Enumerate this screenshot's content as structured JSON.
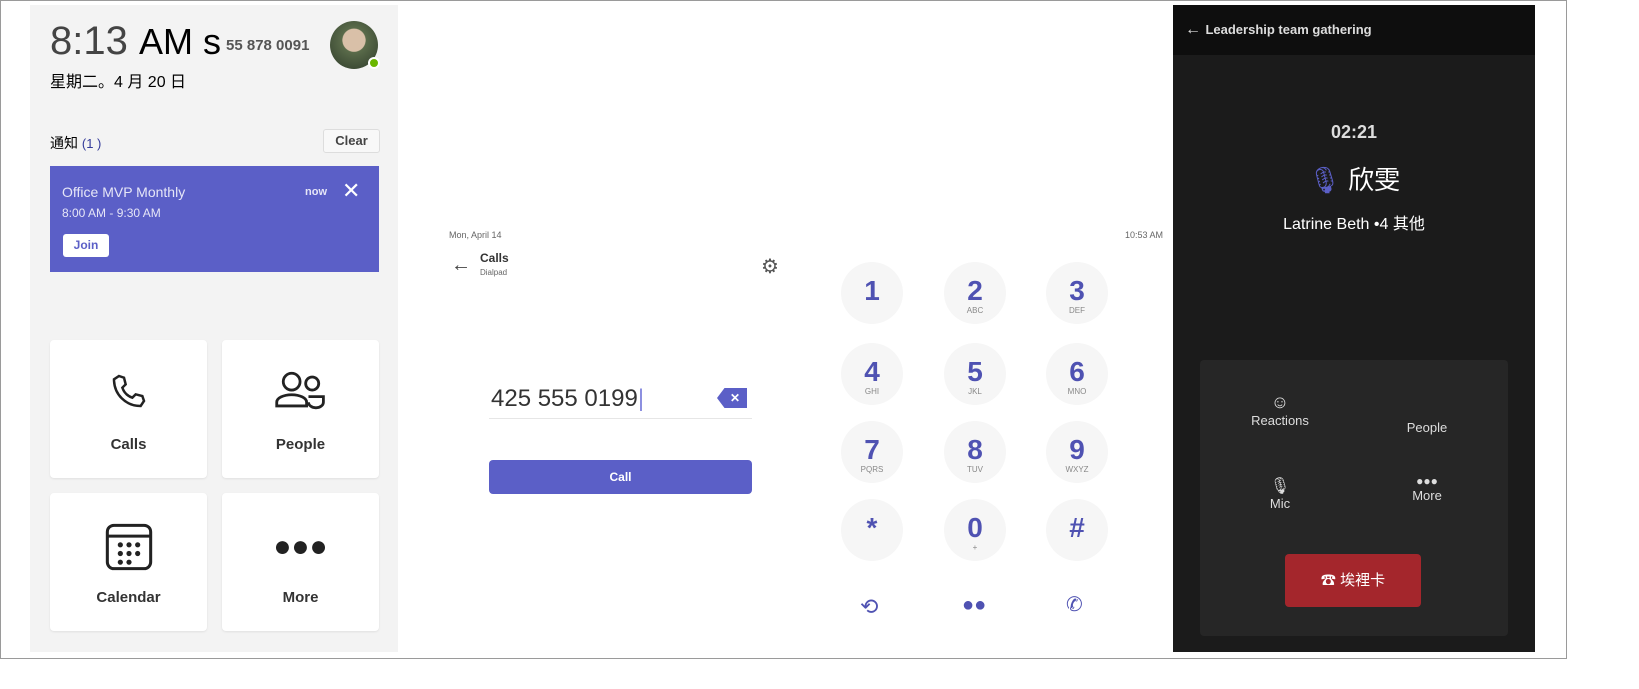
{
  "lock_screen": {
    "time": "8:13",
    "time_suffix": "AM s",
    "phone": "55 878 0091",
    "date": "星期二。4 月 20 日",
    "notifications_label": "通知",
    "notifications_count": "(1 )",
    "clear": "Clear",
    "notification": {
      "title": "Office MVP Monthly",
      "time": "8:00 AM - 9:30 AM",
      "age": "now",
      "join": "Join"
    },
    "tiles": [
      {
        "label": "Calls",
        "icon": "phone-icon"
      },
      {
        "label": "People",
        "icon": "people-icon"
      },
      {
        "label": "Calendar",
        "icon": "calendar-icon"
      },
      {
        "label": "More",
        "icon": "more-icon"
      }
    ]
  },
  "dialpad": {
    "date": "Mon, April 14",
    "clock": "10:53 AM",
    "title": "Calls",
    "subtitle": "Dialpad",
    "number": "425 555 0199",
    "call": "Call",
    "keys": [
      {
        "d": "1",
        "l": ""
      },
      {
        "d": "2",
        "l": "ABC"
      },
      {
        "d": "3",
        "l": "DEF"
      },
      {
        "d": "4",
        "l": "GHI"
      },
      {
        "d": "5",
        "l": "JKL"
      },
      {
        "d": "6",
        "l": "MNO"
      },
      {
        "d": "7",
        "l": "PQRS"
      },
      {
        "d": "8",
        "l": "TUV"
      },
      {
        "d": "9",
        "l": "WXYZ"
      },
      {
        "d": "*",
        "l": ""
      },
      {
        "d": "0",
        "l": "+"
      },
      {
        "d": "#",
        "l": ""
      }
    ],
    "accent": "#5b5fc7"
  },
  "meeting": {
    "title": "Leadership team gathering",
    "duration": "02:21",
    "speaker": "欣雯",
    "participants": "Latrine Beth •4 其他",
    "controls": {
      "reactions": "Reactions",
      "people": "People",
      "mic": "Mic",
      "more": "More"
    },
    "hangup": "埃裡卡",
    "hangup_color": "#a4262c"
  }
}
